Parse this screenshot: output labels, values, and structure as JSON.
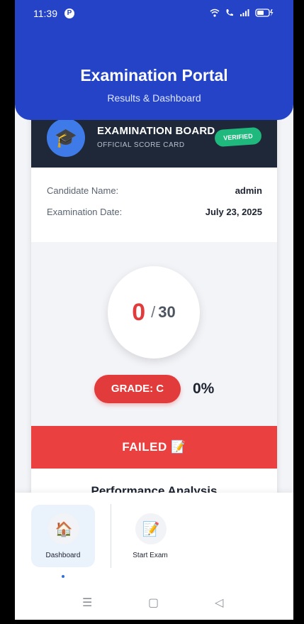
{
  "status_bar": {
    "time": "11:39"
  },
  "header": {
    "title": "Examination Portal",
    "subtitle": "Results & Dashboard"
  },
  "card": {
    "board_title": "EXAMINATION BOARD",
    "board_subtitle": "OFFICIAL SCORE CARD",
    "badge": "VERIFIED",
    "candidate_label": "Candidate Name:",
    "candidate_value": "admin",
    "date_label": "Examination Date:",
    "date_value": "July 23, 2025",
    "score": "0",
    "score_sep": "/",
    "total": "30",
    "grade": "GRADE: C",
    "percent": "0%",
    "result": "FAILED 📝",
    "section_title": "Performance Analysis"
  },
  "bottom_nav": {
    "items": [
      {
        "label": "Dashboard",
        "icon": "house-icon",
        "active": true
      },
      {
        "label": "Start Exam",
        "icon": "memo-icon",
        "active": false
      }
    ]
  },
  "colors": {
    "header_bg": "#2443c7",
    "card_head_bg": "#1e2838",
    "fail_red": "#ea4040",
    "verified_green": "#1fb97e"
  }
}
